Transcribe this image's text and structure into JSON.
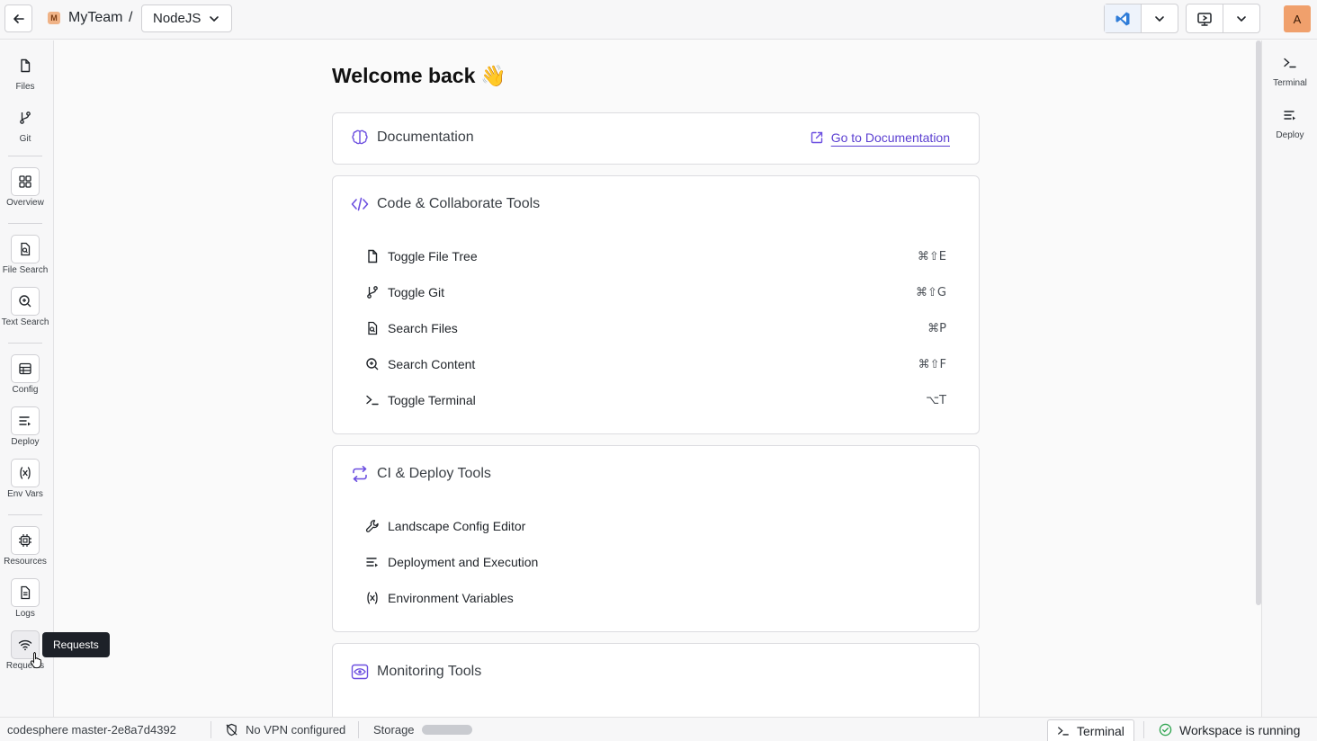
{
  "topbar": {
    "team_badge": "M",
    "team_name": "MyTeam",
    "separator": "/",
    "workspace": "NodeJS",
    "avatar": "A"
  },
  "sidebar": {
    "items": [
      {
        "label": "Files",
        "icon": "file-icon"
      },
      {
        "label": "Git",
        "icon": "git-branch-icon"
      },
      {
        "label": "Overview",
        "icon": "grid-icon"
      },
      {
        "label": "File Search",
        "icon": "file-search-icon"
      },
      {
        "label": "Text Search",
        "icon": "text-search-icon"
      },
      {
        "label": "Config",
        "icon": "config-icon"
      },
      {
        "label": "Deploy",
        "icon": "deploy-icon"
      },
      {
        "label": "Env Vars",
        "icon": "variable-icon"
      },
      {
        "label": "Resources",
        "icon": "chip-icon"
      },
      {
        "label": "Logs",
        "icon": "logs-icon"
      },
      {
        "label": "Requests",
        "icon": "wifi-icon"
      }
    ]
  },
  "tooltip": {
    "text": "Requests"
  },
  "right_sidebar": {
    "items": [
      {
        "label": "Terminal",
        "icon": "terminal-icon"
      },
      {
        "label": "Deploy",
        "icon": "deploy-icon"
      }
    ]
  },
  "main": {
    "welcome": "Welcome back",
    "welcome_emoji": "👋",
    "documentation": {
      "title": "Documentation",
      "link": "Go to Documentation"
    },
    "code_tools": {
      "title": "Code & Collaborate Tools",
      "rows": [
        {
          "label": "Toggle File Tree",
          "shortcut": "⌘⇧E",
          "icon": "file-icon"
        },
        {
          "label": "Toggle Git",
          "shortcut": "⌘⇧G",
          "icon": "git-branch-icon"
        },
        {
          "label": "Search Files",
          "shortcut": "⌘P",
          "icon": "file-search-icon"
        },
        {
          "label": "Search Content",
          "shortcut": "⌘⇧F",
          "icon": "text-search-icon"
        },
        {
          "label": "Toggle Terminal",
          "shortcut": "⌥T",
          "icon": "terminal-icon"
        }
      ]
    },
    "ci_tools": {
      "title": "CI & Deploy Tools",
      "rows": [
        {
          "label": "Landscape Config Editor",
          "icon": "wrench-icon"
        },
        {
          "label": "Deployment and Execution",
          "icon": "deploy-icon"
        },
        {
          "label": "Environment Variables",
          "icon": "variable-icon"
        }
      ]
    },
    "monitoring": {
      "title": "Monitoring Tools"
    }
  },
  "statusbar": {
    "branch": "codesphere master-2e8a7d4392",
    "vpn": "No VPN configured",
    "storage": "Storage",
    "terminal": "Terminal",
    "workspace_status": "Workspace is running"
  },
  "colors": {
    "accent": "#6c4fe0",
    "success": "#2da44e",
    "vscode": "#2f7cd8"
  }
}
